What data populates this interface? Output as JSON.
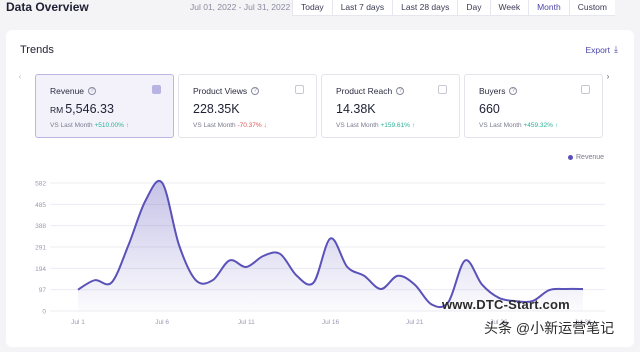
{
  "header": {
    "title": "Data Overview",
    "date_range": "Jul 01, 2022 - Jul 31, 2022",
    "ranges": [
      "Today",
      "Last 7 days",
      "Last 28 days",
      "Day",
      "Week",
      "Month",
      "Custom"
    ],
    "active_range": "Month"
  },
  "trends": {
    "title": "Trends",
    "export_label": "Export",
    "metrics": [
      {
        "label": "Revenue",
        "currency": "RM",
        "value": "5,546.33",
        "compare": "VS Last Month",
        "change": "+510.00%",
        "direction": "up",
        "selected": true
      },
      {
        "label": "Product Views",
        "currency": "",
        "value": "228.35K",
        "compare": "VS Last Month",
        "change": "-70.37%",
        "direction": "down",
        "selected": false
      },
      {
        "label": "Product Reach",
        "currency": "",
        "value": "14.38K",
        "compare": "VS Last Month",
        "change": "+159.61%",
        "direction": "up",
        "selected": false
      },
      {
        "label": "Buyers",
        "currency": "",
        "value": "660",
        "compare": "VS Last Month",
        "change": "+459.32%",
        "direction": "up",
        "selected": false
      }
    ],
    "legend": "Revenue"
  },
  "colors": {
    "accent": "#4a45a8",
    "line": "#5a51b9",
    "up": "#2ab197",
    "down": "#e05353"
  },
  "chart_data": {
    "type": "area",
    "series": [
      {
        "name": "Revenue",
        "x": [
          1,
          2,
          3,
          4,
          5,
          6,
          7,
          8,
          9,
          10,
          11,
          12,
          13,
          14,
          15,
          16,
          17,
          18,
          19,
          20,
          21,
          22,
          23,
          24,
          25,
          26,
          27,
          28,
          29,
          30,
          31
        ],
        "values": [
          97,
          140,
          130,
          300,
          500,
          583,
          300,
          140,
          140,
          230,
          200,
          250,
          260,
          160,
          130,
          330,
          200,
          160,
          100,
          160,
          120,
          30,
          40,
          230,
          120,
          60,
          45,
          45,
          95,
          100,
          100
        ]
      }
    ],
    "y_ticks": [
      "0",
      "97",
      "194",
      "291",
      "388",
      "485",
      "582"
    ],
    "ylim": [
      0,
      582
    ],
    "x_ticks": [
      {
        "x": 1,
        "label": "Jul 1"
      },
      {
        "x": 6,
        "label": "Jul 6"
      },
      {
        "x": 11,
        "label": "Jul 11"
      },
      {
        "x": 16,
        "label": "Jul 16"
      },
      {
        "x": 21,
        "label": "Jul 21"
      },
      {
        "x": 26,
        "label": "Jul 26"
      },
      {
        "x": 31,
        "label": "Jul 31"
      }
    ]
  },
  "watermark": {
    "line1": "www.DTC-Start.com",
    "line2": "头条 @小新运营笔记"
  }
}
